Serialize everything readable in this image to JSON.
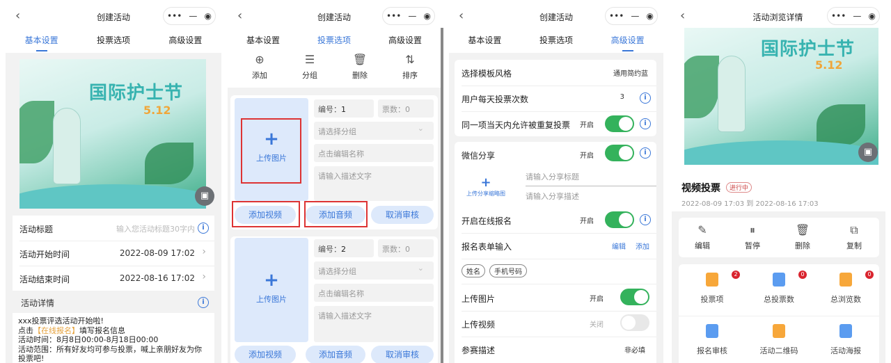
{
  "capsule": {
    "more": "•••",
    "minimize": "—",
    "close": "◉"
  },
  "p1": {
    "title": "创建活动",
    "tabs": [
      "基本设置",
      "投票选项",
      "高级设置"
    ],
    "banner": {
      "title": "国际护士节",
      "date": "5.12"
    },
    "rows": [
      {
        "label": "活动标题",
        "value": "输入您活动标题30字内"
      },
      {
        "label": "活动开始时间",
        "value": "2022-08-09 17:02"
      },
      {
        "label": "活动结束时间",
        "value": "2022-08-16 17:02"
      }
    ],
    "detail_label": "活动详情",
    "detail_lines": [
      "xxx投票评选活动开始啦!",
      "点击",
      "【在线报名】",
      "填写报名信息",
      "活动时间：8月8日00:00-8月18日00:00",
      "活动范围：所有好友均可参与投票，喊上亲朋好友为你投票吧!"
    ]
  },
  "p2": {
    "title": "创建活动",
    "tabs": [
      "基本设置",
      "投票选项",
      "高级设置"
    ],
    "toolbar": [
      "添加",
      "分组",
      "删除",
      "排序"
    ],
    "cards": [
      {
        "no_label": "编号：",
        "no": "1",
        "votes": "票数：0"
      },
      {
        "no_label": "编号：",
        "no": "2",
        "votes": "票数：0"
      }
    ],
    "group_placeholder": "请选择分组",
    "name_placeholder": "点击编辑名称",
    "desc_placeholder": "请输入描述文字",
    "upload": "上传图片",
    "buttons": [
      "添加视频",
      "添加音频",
      "取消审核"
    ]
  },
  "p3": {
    "title": "创建活动",
    "tabs": [
      "基本设置",
      "投票选项",
      "高级设置"
    ],
    "template_label": "选择模板风格",
    "template_value": "通用简约蓝",
    "daily_label": "用户每天投票次数",
    "daily_value": "3",
    "repeat_label": "同一项当天内允许被重复投票",
    "on": "开启",
    "off": "关闭",
    "share_label": "微信分享",
    "share_upload": "上传分享缩略图",
    "share_title_ph": "请输入分享标题",
    "share_desc_ph": "请输入分享描述",
    "signup_label": "开启在线报名",
    "form_label": "报名表单输入",
    "edit": "编辑",
    "add": "添加",
    "fields": [
      "姓名",
      "手机号码"
    ],
    "upload_img_label": "上传图片",
    "upload_video_label": "上传视频",
    "desc_label": "参赛描述",
    "desc_value": "非必填"
  },
  "p4": {
    "title": "活动浏览详情",
    "name": "视频投票",
    "status": "进行中",
    "dates": "2022-08-09 17:03 到 2022-08-16 17:03",
    "actions": [
      "编辑",
      "暂停",
      "删除",
      "复制"
    ],
    "grid": [
      {
        "label": "投票项",
        "badge": "2",
        "color": "#f7a73a"
      },
      {
        "label": "总投票数",
        "badge": "0",
        "color": "#5b9cf0"
      },
      {
        "label": "总浏览数",
        "badge": "0",
        "color": "#f7a73a"
      },
      {
        "label": "报名审核",
        "color": "#5b9cf0"
      },
      {
        "label": "活动二维码",
        "color": "#f7a73a"
      },
      {
        "label": "活动海报",
        "color": "#5b9cf0"
      }
    ]
  },
  "colors": {
    "accent": "#3a77d8",
    "toggle_on": "#34b25c",
    "badge": "#d9242e",
    "highlight": "#e6a23c"
  }
}
